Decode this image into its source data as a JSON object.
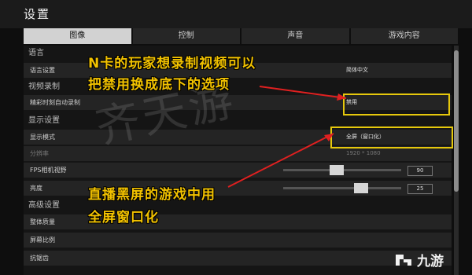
{
  "window": {
    "title": "设置"
  },
  "tabs": [
    {
      "label": "图像",
      "active": true
    },
    {
      "label": "控制",
      "active": false
    },
    {
      "label": "声音",
      "active": false
    },
    {
      "label": "游戏内容",
      "active": false
    }
  ],
  "sections": {
    "language": "语言",
    "video_record": "视频录制",
    "display": "显示设置",
    "advanced": "高级设置"
  },
  "rows": {
    "language_setting": {
      "label": "语言设置",
      "value": "简体中文"
    },
    "highlight_record": {
      "label": "精彩时刻自动录制",
      "value": "禁用"
    },
    "display_mode": {
      "label": "显示模式",
      "value": "全屏（窗口化）"
    },
    "resolution": {
      "label": "分辨率",
      "value": "1920 * 1080"
    },
    "fps_fov": {
      "label": "FPS相机视野",
      "value": "90",
      "level": 0.45
    },
    "brightness": {
      "label": "亮度",
      "value": "25",
      "level": 0.68
    },
    "overall_quality": {
      "label": "整体质量"
    },
    "screen_scale": {
      "label": "屏幕比例"
    },
    "anti_aliasing": {
      "label": "抗锯齿"
    }
  },
  "annotations": {
    "top_line1": "N卡的玩家想录制视频可以",
    "top_line2": "把禁用换成底下的选项",
    "bottom_line1": "直播黑屏的游戏中用",
    "bottom_line2": "全屏窗口化",
    "highlight_color": "#e6c80c",
    "arrow_color": "#e02020"
  },
  "watermark": "齐天游",
  "logo": {
    "icon": "ninegame-logo-icon",
    "text": "九游"
  }
}
